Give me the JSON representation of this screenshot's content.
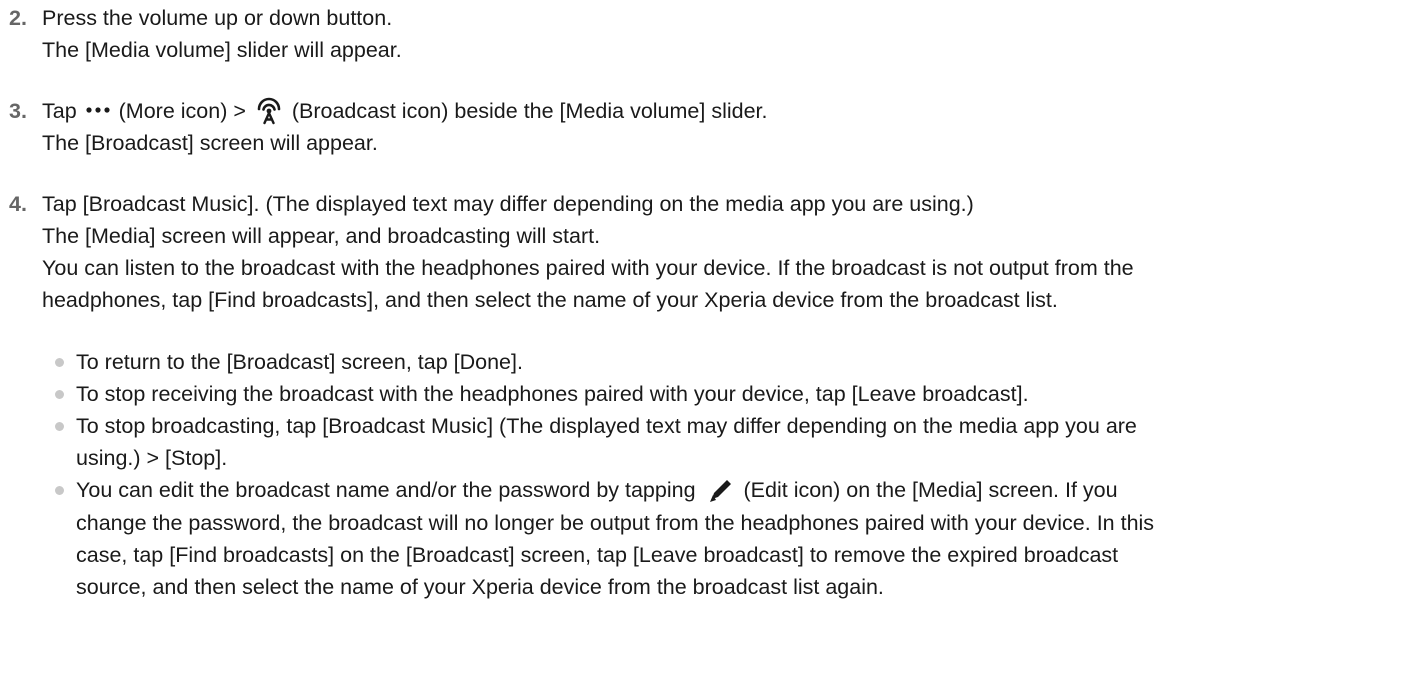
{
  "steps": [
    {
      "number": "2.",
      "line1": "Press the volume up or down button.",
      "line2": "The [Media volume] slider will appear."
    },
    {
      "number": "3.",
      "line1_prefix": "Tap",
      "line1_mid1": "(More icon) >",
      "line1_suffix": "(Broadcast icon) beside the [Media volume] slider.",
      "line2": "The [Broadcast] screen will appear.",
      "icons": [
        "more-icon",
        "broadcast-icon"
      ]
    },
    {
      "number": "4.",
      "line1": "Tap [Broadcast Music]. (The displayed text may differ depending on the media app you are using.)",
      "line2": "The [Media] screen will appear, and broadcasting will start.",
      "line3": "You can listen to the broadcast with the headphones paired with your device. If the broadcast is not output from the",
      "line4": "headphones, tap [Find broadcasts], and then select the name of your Xperia device from the broadcast list."
    }
  ],
  "bullets": [
    {
      "lines": [
        "To return to the [Broadcast] screen, tap [Done]."
      ]
    },
    {
      "lines": [
        "To stop receiving the broadcast with the headphones paired with your device, tap [Leave broadcast]."
      ]
    },
    {
      "lines": [
        "To stop broadcasting, tap [Broadcast Music] (The displayed text may differ depending on the media app you are",
        "using.) > [Stop]."
      ]
    },
    {
      "line1_prefix": "You can edit the broadcast name and/or the password by tapping",
      "line1_suffix": "(Edit icon) on the [Media] screen. If you",
      "lines_rest": [
        "change the password, the broadcast will no longer be output from the headphones paired with your device. In this",
        "case, tap [Find broadcasts] on the [Broadcast] screen, tap [Leave broadcast] to remove the expired broadcast",
        "source, and then select the name of your Xperia device from the broadcast list again."
      ],
      "icons": [
        "edit-icon"
      ]
    }
  ],
  "colors": {
    "text": "#1a1a1a",
    "step_number": "#666666",
    "bullet": "#c8c8c8"
  }
}
